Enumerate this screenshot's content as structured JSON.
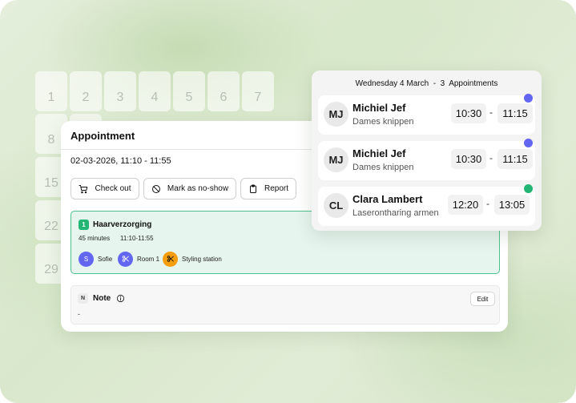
{
  "calendar": {
    "days": [
      "1",
      "2",
      "3",
      "4",
      "5",
      "6",
      "7",
      "8",
      "15",
      "22",
      "29"
    ]
  },
  "appointment": {
    "title": "Appointment",
    "datetime": "02-03-2026, 11:10 - 11:55",
    "actions": {
      "checkout_label": "Check out",
      "noshow_label": "Mark as no-show",
      "report_label": "Report"
    },
    "service": {
      "number": "1",
      "name": "Haarverzorging",
      "duration": "45 minutes",
      "time": "11:10-11:55",
      "resources": [
        {
          "initial": "S",
          "label": "Sofie",
          "color": "#6366f1",
          "icon": "letter"
        },
        {
          "initial": "",
          "label": "Room 1",
          "color": "#6366f1",
          "icon": "scissors-icon"
        },
        {
          "initial": "",
          "label": "Styling station",
          "color": "#f59e0b",
          "icon": "scissors-icon"
        }
      ]
    },
    "note": {
      "badge": "N",
      "title": "Note",
      "edit_label": "Edit",
      "body": "-"
    }
  },
  "day_panel": {
    "header": "Wednesday 4 March  -  3  Appointments",
    "appointments": [
      {
        "initials": "MJ",
        "name": "Michiel Jef",
        "service": "Dames knippen",
        "start": "10:30",
        "end": "11:15",
        "status_color": "#6366f1"
      },
      {
        "initials": "MJ",
        "name": "Michiel Jef",
        "service": "Dames knippen",
        "start": "10:30",
        "end": "11:15",
        "status_color": "#6366f1"
      },
      {
        "initials": "CL",
        "name": "Clara Lambert",
        "service": "Laserontharing armen",
        "start": "12:20",
        "end": "13:05",
        "status_color": "#22b573"
      }
    ],
    "separator": "-"
  }
}
